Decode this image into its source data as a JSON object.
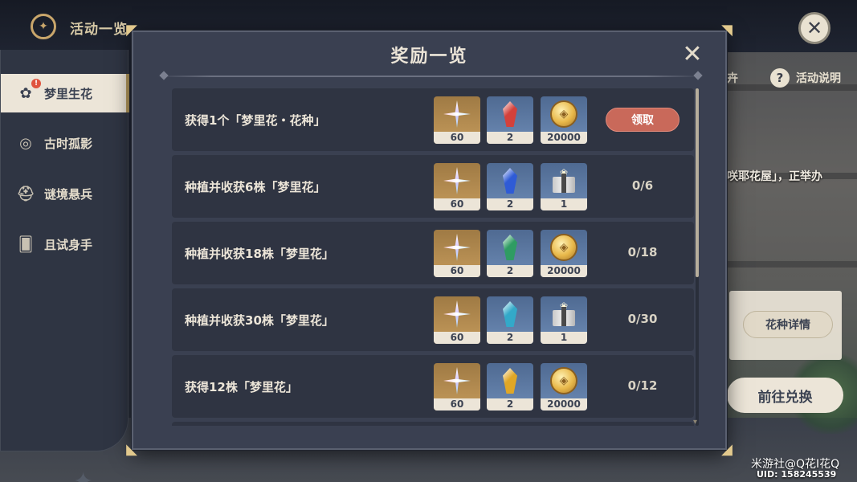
{
  "topbar": {
    "title": "活动一览"
  },
  "sidebar": {
    "items": [
      {
        "label": "梦里生花",
        "active": true,
        "icon": "flower-pot-icon",
        "badge": "!"
      },
      {
        "label": "古时孤影",
        "active": false,
        "icon": "compass-icon"
      },
      {
        "label": "谜境悬兵",
        "active": false,
        "icon": "helmet-icon"
      },
      {
        "label": "且试身手",
        "active": false,
        "icon": "cards-icon"
      }
    ]
  },
  "right_panel": {
    "partial_text": "卉",
    "help_label": "活动说明",
    "story_fragment": "咲耶花屋」，正举办",
    "seed_details_label": "花种详情",
    "exchange_label": "前往兑换"
  },
  "modal": {
    "title": "奖励一览",
    "rows": [
      {
        "task": "获得1个「梦里花・花种」",
        "rewards": [
          {
            "icon": "primogem-icon",
            "count": "60",
            "crystal": "red"
          },
          {
            "icon": "crystal-chunk-icon",
            "count": "2",
            "color": "#d3413b"
          },
          {
            "icon": "mora-icon",
            "count": "20000"
          }
        ],
        "action": "领取",
        "claimable": true
      },
      {
        "task": "种植并收获6株「梦里花」",
        "rewards": [
          {
            "icon": "primogem-icon",
            "count": "60"
          },
          {
            "icon": "crystal-chunk-icon",
            "count": "2",
            "color": "#2f5bd6"
          },
          {
            "icon": "gift-box-icon",
            "count": "1"
          }
        ],
        "action": "0/6",
        "claimable": false
      },
      {
        "task": "种植并收获18株「梦里花」",
        "rewards": [
          {
            "icon": "primogem-icon",
            "count": "60"
          },
          {
            "icon": "crystal-chunk-icon",
            "count": "2",
            "color": "#2f9c63"
          },
          {
            "icon": "mora-icon",
            "count": "20000"
          }
        ],
        "action": "0/18",
        "claimable": false
      },
      {
        "task": "种植并收获30株「梦里花」",
        "rewards": [
          {
            "icon": "primogem-icon",
            "count": "60"
          },
          {
            "icon": "crystal-chunk-icon",
            "count": "2",
            "color": "#33a9c9"
          },
          {
            "icon": "gift-box-icon",
            "count": "1"
          }
        ],
        "action": "0/30",
        "claimable": false
      },
      {
        "task": "获得12株「梦里花」",
        "rewards": [
          {
            "icon": "primogem-icon",
            "count": "60"
          },
          {
            "icon": "crystal-chunk-icon",
            "count": "2",
            "color": "#e0a726"
          },
          {
            "icon": "mora-icon",
            "count": "20000"
          }
        ],
        "action": "0/12",
        "claimable": false
      }
    ],
    "scroll_fraction": 0.56
  },
  "watermark": {
    "line1": "米游社@Q花I花Q",
    "line2": "UID: 158245539"
  },
  "colors": {
    "claim": "#c9695a",
    "panel": "#3a4051",
    "row": "#2f3442",
    "cream": "#ece5d8",
    "gold": "#e2c98d"
  }
}
